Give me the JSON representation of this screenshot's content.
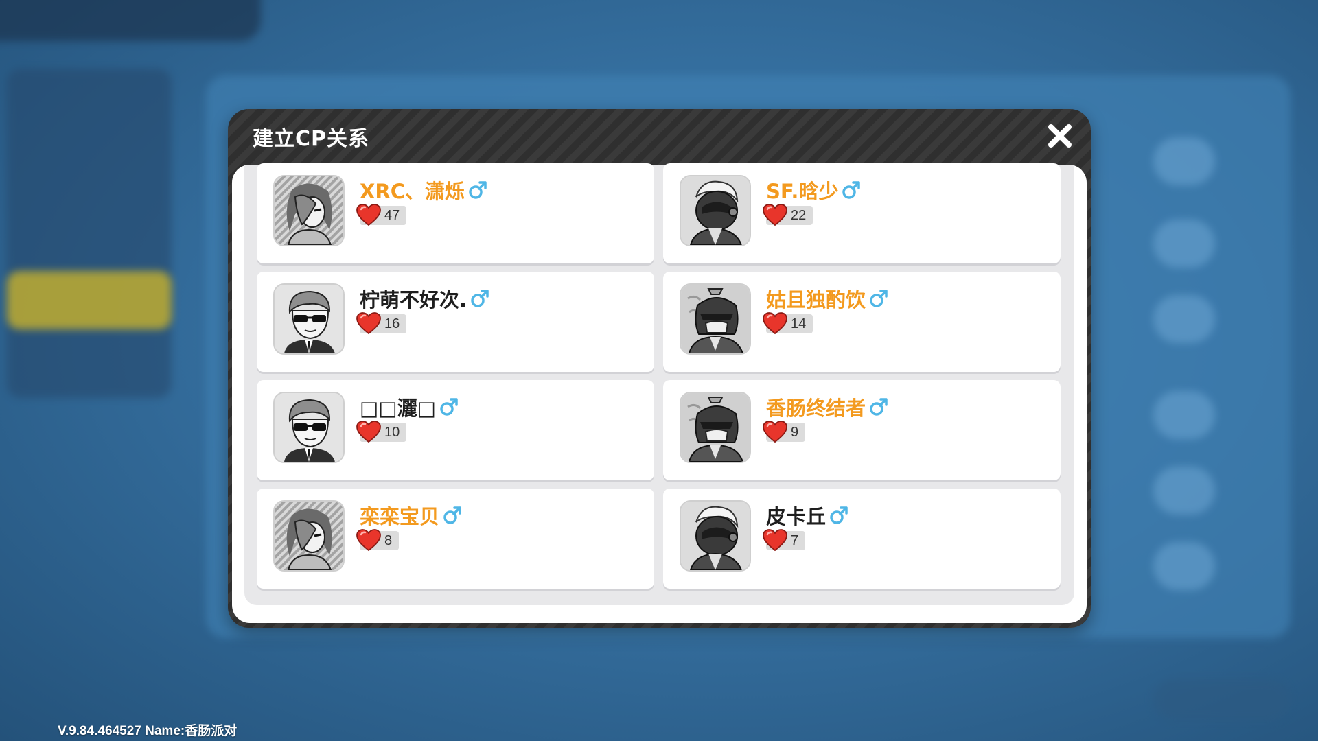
{
  "dialog": {
    "title": "建立CP关系"
  },
  "players": [
    {
      "name": "XRC、潇烁",
      "name_color": "orange",
      "hearts": "47",
      "avatar": "long-hair-avatar"
    },
    {
      "name": "SF.晗少",
      "name_color": "orange",
      "hearts": "22",
      "avatar": "helmet-avatar"
    },
    {
      "name": "柠萌不好次.",
      "name_color": "black",
      "hearts": "16",
      "avatar": "sunglasses-avatar"
    },
    {
      "name": "姑且独酌饮",
      "name_color": "orange",
      "hearts": "14",
      "avatar": "masked-ninja-avatar"
    },
    {
      "name": "□□灑□",
      "name_color": "black",
      "hearts": "10",
      "avatar": "sunglasses-avatar"
    },
    {
      "name": "香肠终结者",
      "name_color": "orange",
      "hearts": "9",
      "avatar": "masked-ninja-avatar"
    },
    {
      "name": "栾栾宝贝",
      "name_color": "orange",
      "hearts": "8",
      "avatar": "long-hair-avatar"
    },
    {
      "name": "皮卡丘",
      "name_color": "black",
      "hearts": "7",
      "avatar": "helmet-avatar"
    }
  ],
  "icons": {
    "gender": "male-symbol-icon",
    "heart": "heart-icon",
    "close": "close-icon"
  },
  "colors": {
    "orange_name": "#f39a1f",
    "male_symbol": "#4fb6e6",
    "heart": "#e8352b"
  },
  "footer": {
    "version_text": "V.9.84.464527 Name:香肠派对"
  }
}
